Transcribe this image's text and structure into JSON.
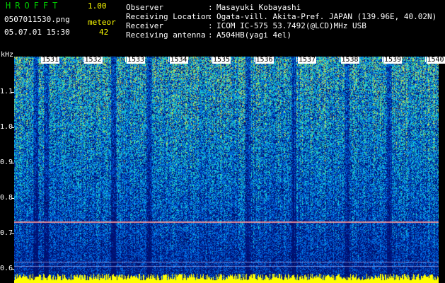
{
  "header": {
    "logo": "HROFFT",
    "version": "1.00",
    "filename": "0507011530.png",
    "datetime": "05.07.01 15:30",
    "mode_label": "meteor",
    "count": "42"
  },
  "info": [
    {
      "label": "Observer",
      "value": "Masayuki Kobayashi"
    },
    {
      "label": "Receiving Location",
      "value": "Ogata-vill. Akita-Pref. JAPAN (139.96E, 40.02N)"
    },
    {
      "label": "Receiver",
      "value": "ICOM IC-575 53.7492(@LCD)MHz USB"
    },
    {
      "label": "Receiving antenna",
      "value": "A504HB(yagi 4el)"
    }
  ],
  "axis": {
    "unit": "kHz",
    "freq_ticks": [
      "1.1",
      "1.0",
      "0.9",
      "0.8",
      "0.7",
      "0.6"
    ],
    "minute_ticks": [
      "1531",
      "1532",
      "1533",
      "1534",
      "1535",
      "1536",
      "1537",
      "1538",
      "1539",
      "1540"
    ]
  },
  "colors": {
    "background": "#000000",
    "logo": "#00c800",
    "header_text": "#ffff00",
    "info_text": "#ffffff",
    "noise_low": "#00107a",
    "noise_mid": "#1a5cff",
    "noise_high": "#39d3b0",
    "baseline": "#ffff00",
    "carrier": "#ff9090"
  }
}
